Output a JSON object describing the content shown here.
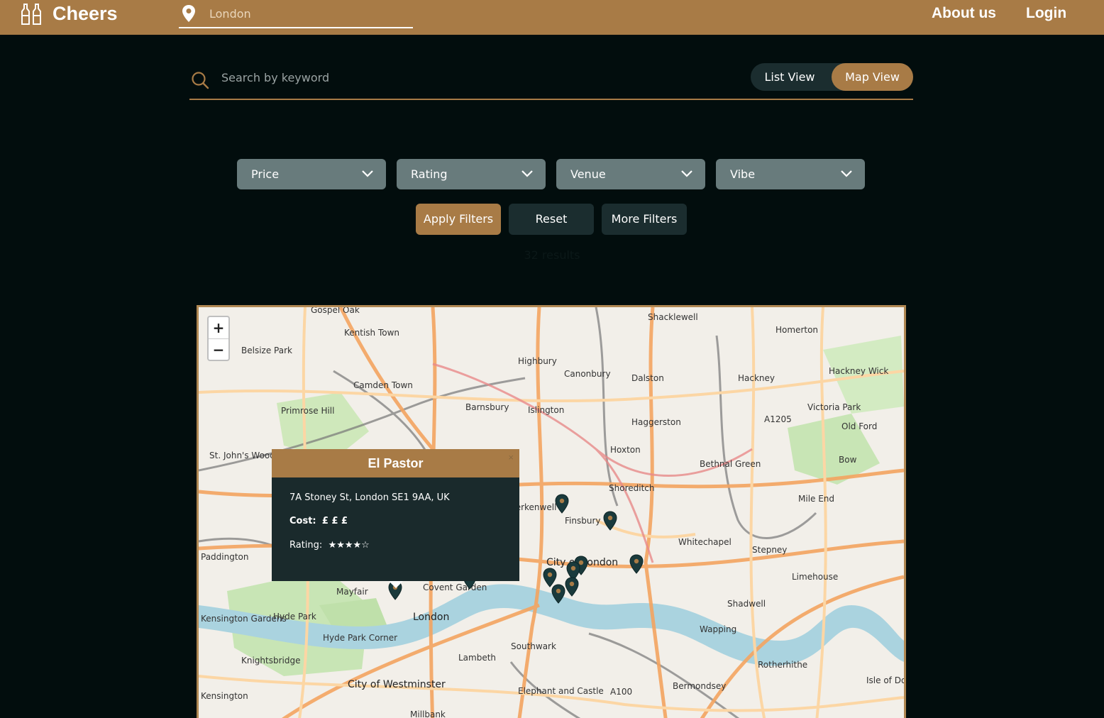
{
  "header": {
    "brand": "Cheers",
    "location_placeholder": "London",
    "nav": [
      "About us",
      "Login"
    ]
  },
  "search": {
    "placeholder": "Search by keyword",
    "views": [
      "List View",
      "Map View"
    ],
    "active_view": "Map View"
  },
  "filters": {
    "dropdowns": [
      "Price",
      "Rating",
      "Venue",
      "Vibe"
    ],
    "buttons": {
      "apply": "Apply Filters",
      "reset": "Reset",
      "more": "More Filters"
    }
  },
  "results_text": "32 results",
  "map": {
    "zoom_in": "+",
    "zoom_out": "−",
    "labels": [
      "Gospel Oak",
      "Kentish Town",
      "Belsize Park",
      "Highbury",
      "Canonbury",
      "Dalston",
      "Shacklewell",
      "Homerton",
      "Hackney",
      "Hackney Wick",
      "Camden Town",
      "Primrose Hill",
      "Barnsbury",
      "Islington",
      "Haggerston",
      "Victoria Park",
      "St. John's Wood",
      "Hoxton",
      "Bethnal Green",
      "Bow",
      "Shoreditch",
      "Mile End",
      "Clerkenwell",
      "Finsbury",
      "Whitechapel",
      "Stepney",
      "Paddington",
      "City of London",
      "Limehouse",
      "Mayfair",
      "Covent Garden",
      "Shadwell",
      "London",
      "Hyde Park",
      "Kensington Gardens",
      "Wapping",
      "Southwark",
      "Knightsbridge",
      "Lambeth",
      "Rotherhithe",
      "City of Westminster",
      "Elephant and Castle",
      "Bermondsey",
      "Isle of Dogs",
      "Kensington",
      "Millbank",
      "Hyde Park Corner",
      "Old Ford",
      "A1205",
      "A100"
    ],
    "popup": {
      "title": "El Pastor",
      "close": "×",
      "address": "7A Stoney St, London SE1 9AA, UK",
      "cost_label": "Cost:",
      "cost_value": "£ £ £",
      "rating_label": "Rating:",
      "rating_stars": "★★★★☆"
    }
  },
  "colors": {
    "brand": "#a87b46",
    "background": "#020d0d",
    "dropdown": "#687b7c",
    "dark_button": "#1b2d2f",
    "marker": "#1a3a3c"
  }
}
